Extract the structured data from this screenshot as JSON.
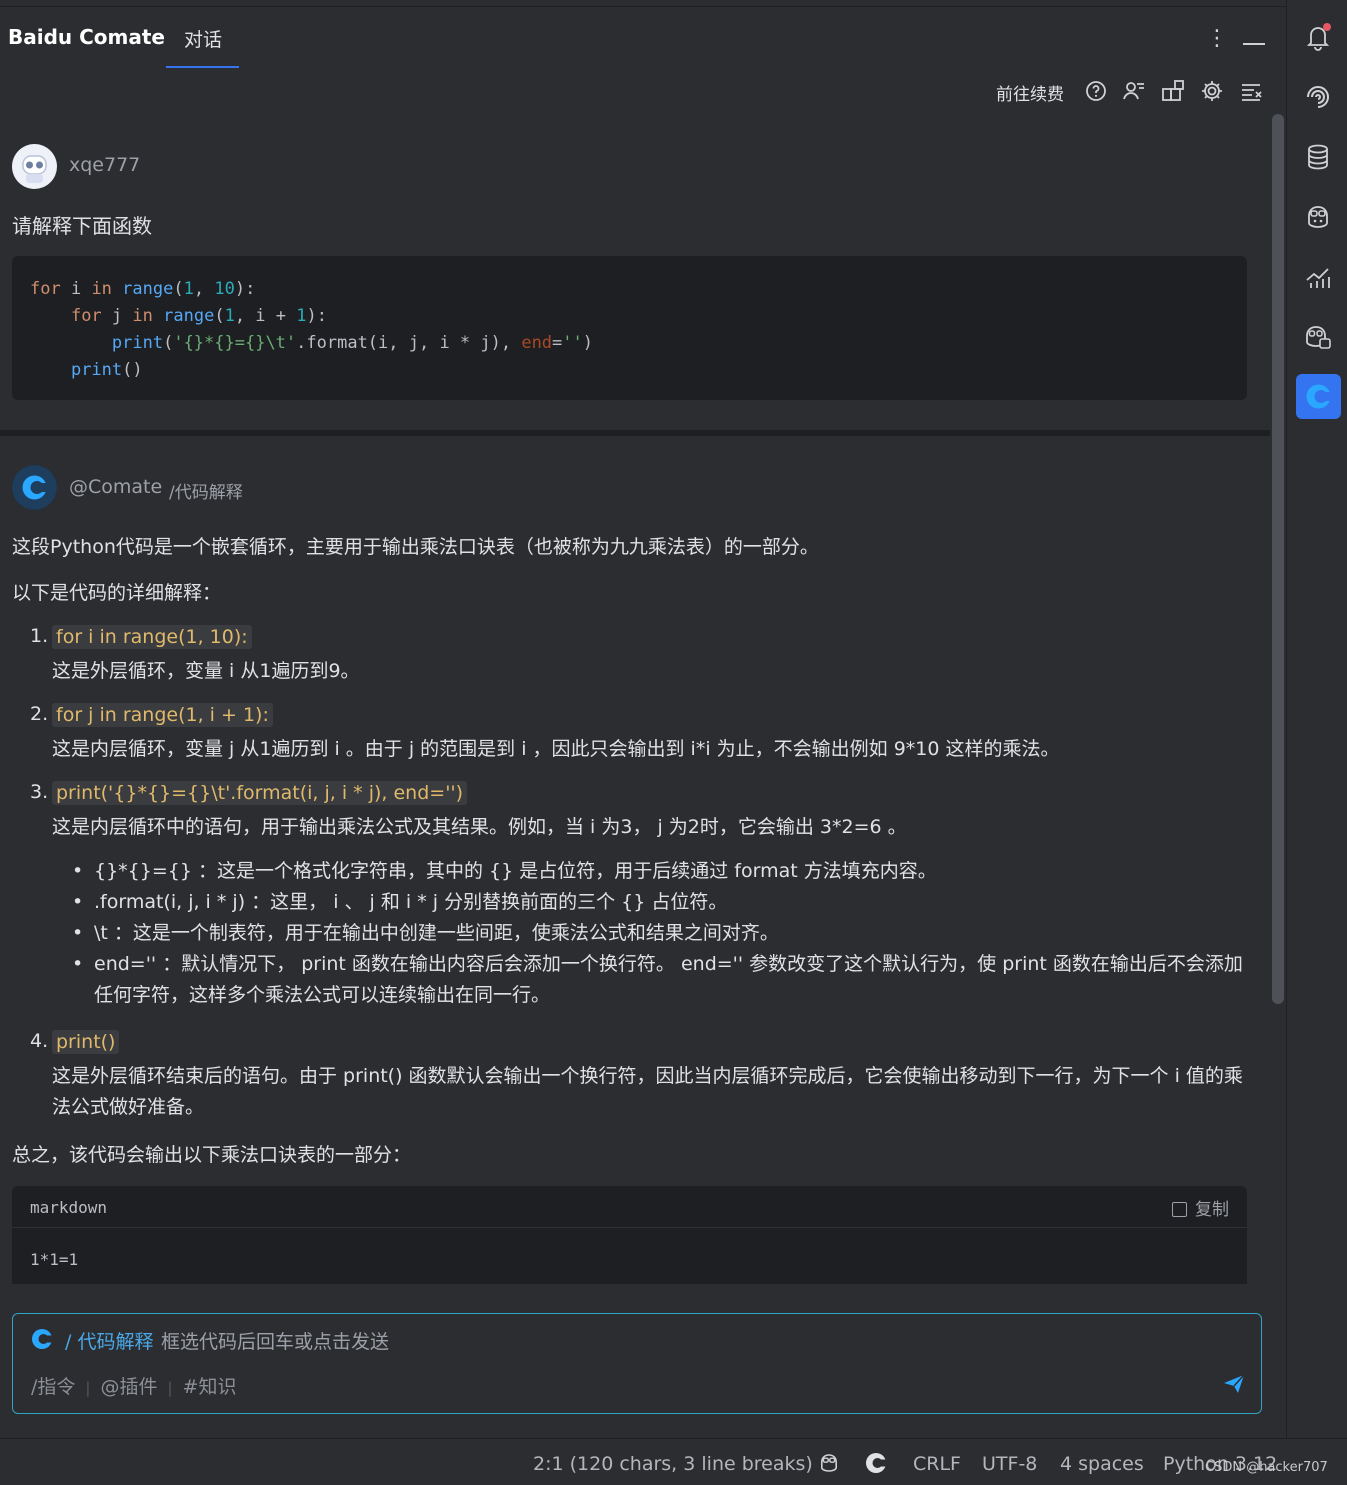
{
  "header": {
    "app_title": "Baidu Comate",
    "tab_label": "对话"
  },
  "toolbar": {
    "renew_label": "前往续费"
  },
  "user_message": {
    "username": "xqe777",
    "text": "请解释下面函数",
    "code_lines": [
      "for i in range(1, 10):",
      "    for j in range(1, i + 1):",
      "        print('{}*{}={}\\t'.format(i, j, i * j), end='')",
      "    print()"
    ]
  },
  "bot_message": {
    "name": "@Comate",
    "command": "/代码解释",
    "intro": "这段Python代码是一个嵌套循环，主要用于输出乘法口诀表（也被称为九九乘法表）的一部分。",
    "detail_heading": "以下是代码的详细解释：",
    "items": [
      {
        "num": "1.",
        "head": "for i in range(1, 10):",
        "desc": "这是外层循环，变量 i 从1遍历到9。"
      },
      {
        "num": "2.",
        "head": "for j in range(1, i + 1):",
        "desc": "这是内层循环，变量 j 从1遍历到 i 。由于 j 的范围是到 i ，因此只会输出到 i*i 为止，不会输出例如 9*10 这样的乘法。"
      },
      {
        "num": "3.",
        "head": "print('{}*{}={}\\t'.format(i, j, i * j), end='')",
        "desc": "这是内层循环中的语句，用于输出乘法公式及其结果。例如，当 i 为3， j 为2时，它会输出 3*2=6 。"
      },
      {
        "num": "4.",
        "head": "print()",
        "desc": "这是外层循环结束后的语句。由于 print() 函数默认会输出一个换行符，因此当内层循环完成后，它会使输出移动到下一行，为下一个 i 值的乘法公式做好准备。"
      }
    ],
    "bullets": [
      "{}*{}={} ：这是一个格式化字符串，其中的 {} 是占位符，用于后续通过 format 方法填充内容。",
      ".format(i, j, i * j) ：这里， i 、 j 和 i * j 分别替换前面的三个 {} 占位符。",
      "\\t ：这是一个制表符，用于在输出中创建一些间距，使乘法公式和结果之间对齐。",
      "end='' ：默认情况下， print 函数在输出内容后会添加一个换行符。 end='' 参数改变了这个默认行为，使 print 函数在输出后不会添加任何字符，这样多个乘法公式可以连续输出在同一行。"
    ],
    "summary": "总之，该代码会输出以下乘法口诀表的一部分：",
    "code_block": {
      "lang": "markdown",
      "copy_label": "复制",
      "first_line": "1*1=1"
    }
  },
  "input": {
    "command": "/ 代码解释",
    "placeholder": "框选代码后回车或点击发送",
    "hints": [
      "/指令",
      "@插件",
      "#知识"
    ]
  },
  "statusbar": {
    "position": "2:1 (120 chars, 3 line breaks)",
    "line_ending": "CRLF",
    "encoding": "UTF-8",
    "indent": "4 spaces",
    "interpreter": "Python 3.12"
  },
  "watermark": "CSDN @hacker707",
  "colors": {
    "accent": "#3574f0",
    "input_border": "#31a3c4",
    "inline_code": "#e0b96a"
  }
}
